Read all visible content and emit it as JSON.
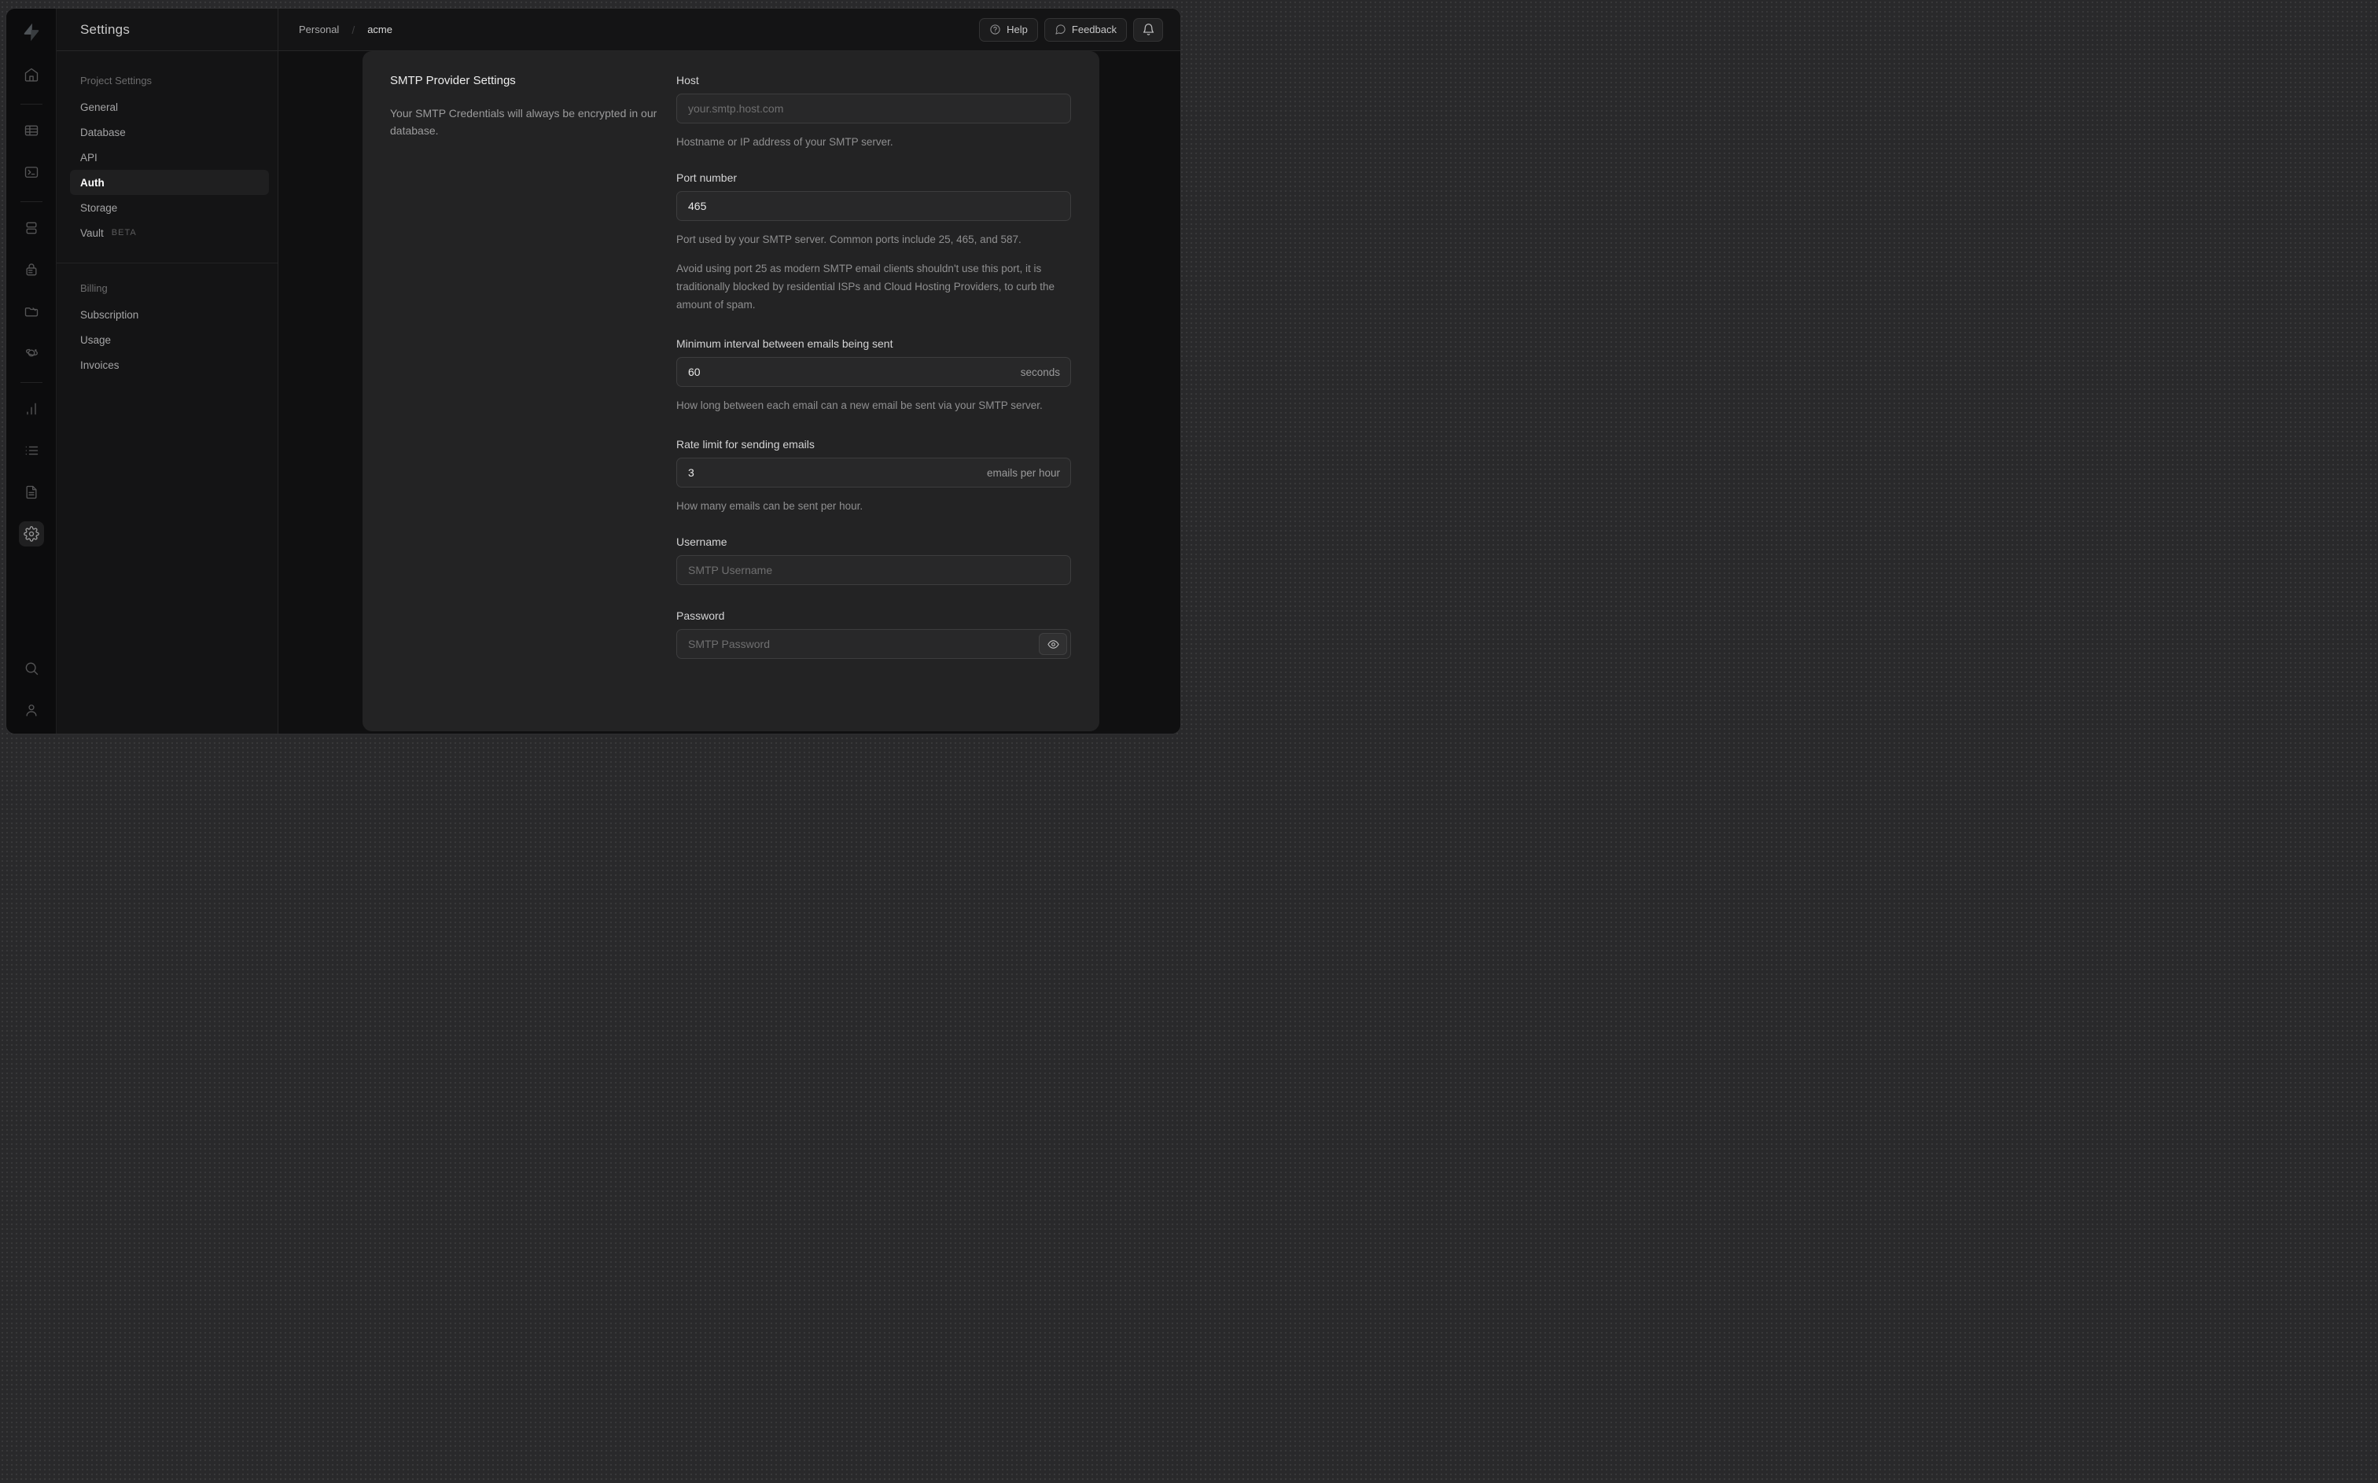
{
  "colors": {
    "frame": "#29292b",
    "app_background": "#111112",
    "rail_background": "#0c0c0d",
    "menu_background": "#141415",
    "panel_background": "#232324",
    "input_background": "#282829",
    "input_border": "#3d3d3e",
    "active_item_background": "#1f1f20",
    "text_primary": "#ededed",
    "text_secondary": "#9b9b9c"
  },
  "rail": {
    "icons": [
      "supabase-logo",
      "home",
      "table-editor",
      "sql-editor",
      "database",
      "auth",
      "storage",
      "edge-functions",
      "reports",
      "logs",
      "api-docs",
      "project-settings",
      "search",
      "account"
    ],
    "active_icon": "project-settings"
  },
  "settings_menu": {
    "title": "Settings",
    "sections": [
      {
        "label": "Project Settings",
        "items": [
          {
            "label": "General"
          },
          {
            "label": "Database"
          },
          {
            "label": "API"
          },
          {
            "label": "Auth",
            "active": true
          },
          {
            "label": "Storage"
          },
          {
            "label": "Vault",
            "badge": "BETA"
          }
        ]
      },
      {
        "label": "Billing",
        "items": [
          {
            "label": "Subscription"
          },
          {
            "label": "Usage"
          },
          {
            "label": "Invoices"
          }
        ]
      }
    ]
  },
  "topbar": {
    "breadcrumb": {
      "org": "Personal",
      "separator": "/",
      "project": "acme"
    },
    "help_label": "Help",
    "feedback_label": "Feedback"
  },
  "smtp": {
    "heading": "SMTP Provider Settings",
    "description": "Your SMTP Credentials will always be encrypted in our database.",
    "fields": {
      "host": {
        "label": "Host",
        "placeholder": "your.smtp.host.com",
        "help": "Hostname or IP address of your SMTP server."
      },
      "port": {
        "label": "Port number",
        "value": "465",
        "help1": "Port used by your SMTP server. Common ports include 25, 465, and 587.",
        "help2": "Avoid using port 25 as modern SMTP email clients shouldn't use this port, it is traditionally blocked by residential ISPs and Cloud Hosting Providers, to curb the amount of spam."
      },
      "interval": {
        "label": "Minimum interval between emails being sent",
        "value": "60",
        "suffix": "seconds",
        "help": "How long between each email can a new email be sent via your SMTP server."
      },
      "rate": {
        "label": "Rate limit for sending emails",
        "value": "3",
        "suffix": "emails per hour",
        "help": "How many emails can be sent per hour."
      },
      "username": {
        "label": "Username",
        "placeholder": "SMTP Username"
      },
      "password": {
        "label": "Password",
        "placeholder": "SMTP Password"
      }
    }
  }
}
